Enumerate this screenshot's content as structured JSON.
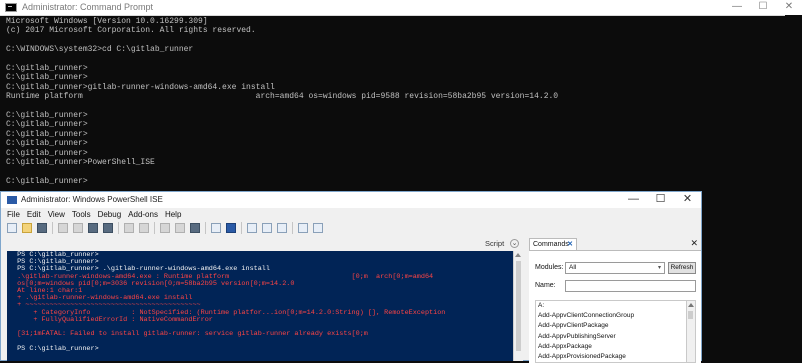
{
  "cmd": {
    "title": "Administrator: Command Prompt",
    "window_buttons": {
      "minimize": "—",
      "maximize": "☐",
      "close": "✕"
    },
    "lines": [
      "Microsoft Windows [Version 10.0.16299.309]",
      "(c) 2017 Microsoft Corporation. All rights reserved.",
      "",
      "C:\\WINDOWS\\system32>cd C:\\gitlab_runner",
      "",
      "C:\\gitlab_runner>",
      "C:\\gitlab_runner>",
      "C:\\gitlab_runner>gitlab-runner-windows-amd64.exe install",
      "Runtime platform                                    arch=amd64 os=windows pid=9588 revision=58ba2b95 version=14.2.0",
      "",
      "C:\\gitlab_runner>",
      "C:\\gitlab_runner>",
      "C:\\gitlab_runner>",
      "C:\\gitlab_runner>",
      "C:\\gitlab_runner>",
      "C:\\gitlab_runner>PowerShell_ISE",
      "",
      "C:\\gitlab_runner>"
    ]
  },
  "ise": {
    "title": "Administrator: Windows PowerShell ISE",
    "window_buttons": {
      "minimize": "—",
      "maximize": "☐",
      "close": "✕"
    },
    "menu": [
      "File",
      "Edit",
      "View",
      "Tools",
      "Debug",
      "Add-ons",
      "Help"
    ],
    "toolbar_icons": [
      "new-file-icon",
      "open-file-icon",
      "save-icon",
      "cut-icon",
      "copy-icon",
      "paste-icon",
      "clear-icon",
      "undo-icon",
      "redo-icon",
      "run-icon",
      "run-selection-icon",
      "stop-icon",
      "remote-icon",
      "powershell-tab-icon",
      "layout-top-icon",
      "layout-right-icon",
      "layout-max-icon",
      "show-commands-icon",
      "show-addon-icon"
    ],
    "script_tab_label": "Script",
    "console": [
      {
        "c": "w",
        "t": " PS C:\\gitlab_runner>"
      },
      {
        "c": "w",
        "t": " PS C:\\gitlab_runner>"
      },
      {
        "c": "w",
        "t": " PS C:\\gitlab_runner> .\\gitlab-runner-windows-amd64.exe install"
      },
      {
        "c": "r",
        "t": " .\\gitlab-runner-windows-amd64.exe : Runtime platform                              [0;m  arch[0;m=amd64"
      },
      {
        "c": "r",
        "t": " os[0;m=windows pid[0;m=3036 revision[0;m=58ba2b95 version[0;m=14.2.0"
      },
      {
        "c": "r",
        "t": " At line:1 char:1"
      },
      {
        "c": "r",
        "t": " + .\\gitlab-runner-windows-amd64.exe install"
      },
      {
        "c": "r",
        "t": " + ~~~~~~~~~~~~~~~~~~~~~~~~~~~~~~~~~~~~~~~~~~~"
      },
      {
        "c": "r",
        "t": "     + CategoryInfo          : NotSpecified: (Runtime platfor...ion[0;m=14.2.0:String) [], RemoteException"
      },
      {
        "c": "r",
        "t": "     + FullyQualifiedErrorId : NativeCommandError"
      },
      {
        "c": "r",
        "t": ""
      },
      {
        "c": "r",
        "t": " [31;1mFATAL: Failed to install gitlab-runner: service gitlab-runner already exists[0;m"
      },
      {
        "c": "r",
        "t": ""
      },
      {
        "c": "w",
        "t": " PS C:\\gitlab_runner>"
      }
    ],
    "commands": {
      "tab_label": "Commands",
      "tab_close": "✕",
      "pane_close": "✕",
      "modules_label": "Modules:",
      "modules_value": "All",
      "refresh_label": "Refresh",
      "name_label": "Name:",
      "name_value": "",
      "items": [
        "A:",
        "Add-AppvClientConnectionGroup",
        "Add-AppvClientPackage",
        "Add-AppvPublishingServer",
        "Add-AppxPackage",
        "Add-AppxProvisionedPackage"
      ]
    }
  }
}
